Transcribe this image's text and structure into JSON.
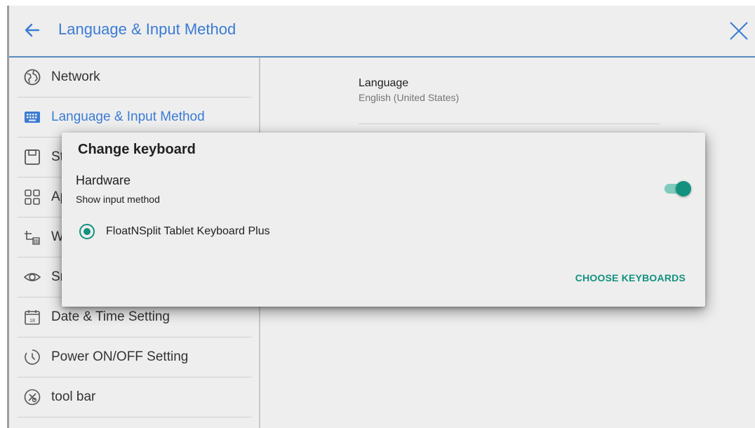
{
  "header": {
    "title": "Language & Input Method"
  },
  "sidebar": {
    "items": [
      {
        "label": "Network",
        "icon": "globe-icon"
      },
      {
        "label": "Language & Input Method",
        "icon": "keyboard-icon",
        "active": true
      },
      {
        "label": "St",
        "icon": "storage-icon"
      },
      {
        "label": "Ap",
        "icon": "apps-icon"
      },
      {
        "label": "W",
        "icon": "wallpaper-icon"
      },
      {
        "label": "Sr",
        "icon": "eye-icon"
      },
      {
        "label": "Date & Time Setting",
        "icon": "calendar-icon"
      },
      {
        "label": "Power ON/OFF Setting",
        "icon": "timer-icon"
      },
      {
        "label": "tool bar",
        "icon": "toolbar-icon"
      }
    ]
  },
  "content": {
    "language": {
      "title": "Language",
      "value": "English (United States)"
    }
  },
  "dialog": {
    "title": "Change keyboard",
    "hardware_title": "Hardware",
    "hardware_subtitle": "Show input method",
    "toggle_on": true,
    "keyboard_option": "FloatNSplit Tablet Keyboard Plus",
    "choose_button": "CHOOSE KEYBOARDS"
  },
  "colors": {
    "accent_blue": "#3a7bd5",
    "accent_teal": "#12917f",
    "background": "#eeeeee"
  }
}
